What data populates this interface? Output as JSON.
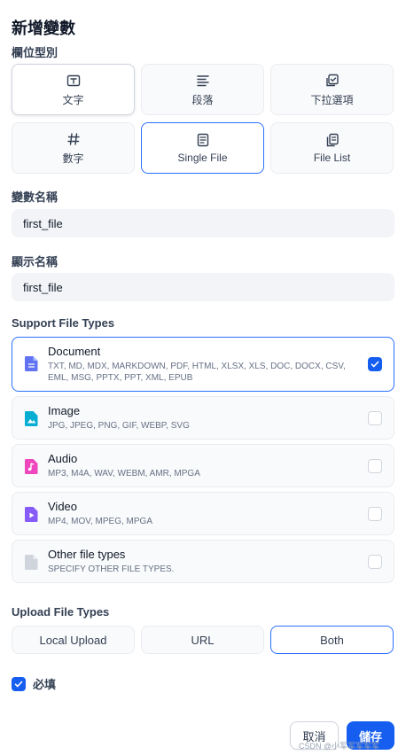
{
  "title": "新增變數",
  "field_type": {
    "label": "欄位型別",
    "options": [
      {
        "label": "文字",
        "icon": "text-input-icon"
      },
      {
        "label": "段落",
        "icon": "paragraph-icon"
      },
      {
        "label": "下拉選項",
        "icon": "dropdown-select-icon"
      },
      {
        "label": "數字",
        "icon": "number-hash-icon"
      },
      {
        "label": "Single File",
        "icon": "single-file-icon"
      },
      {
        "label": "File List",
        "icon": "file-list-icon"
      }
    ],
    "selected": "Single File"
  },
  "variable_name": {
    "label": "變數名稱",
    "value": "first_file"
  },
  "display_name": {
    "label": "顯示名稱",
    "value": "first_file"
  },
  "support_file_types": {
    "label": "Support File Types",
    "items": [
      {
        "name": "Document",
        "extensions": "TXT, MD, MDX, MARKDOWN, PDF, HTML, XLSX, XLS, DOC, DOCX, CSV, EML, MSG, PPTX, PPT, XML, EPUB",
        "checked": true,
        "color": "#6172f3"
      },
      {
        "name": "Image",
        "extensions": "JPG, JPEG, PNG, GIF, WEBP, SVG",
        "checked": false,
        "color": "#06aed4"
      },
      {
        "name": "Audio",
        "extensions": "MP3, M4A, WAV, WEBM, AMR, MPGA",
        "checked": false,
        "color": "#ee46bc"
      },
      {
        "name": "Video",
        "extensions": "MP4, MOV, MPEG, MPGA",
        "checked": false,
        "color": "#875bf7"
      },
      {
        "name": "Other file types",
        "extensions": "SPECIFY OTHER FILE TYPES.",
        "checked": false,
        "color": "#d0d5dd"
      }
    ]
  },
  "upload_file_types": {
    "label": "Upload File Types",
    "options": [
      "Local Upload",
      "URL",
      "Both"
    ],
    "selected": "Both"
  },
  "required": {
    "label": "必填",
    "checked": true
  },
  "actions": {
    "cancel": "取消",
    "save": "儲存"
  },
  "watermark": "CSDN @小军军军军军",
  "colors": {
    "accent": "#155eef",
    "selected_border": "#2970ff"
  }
}
